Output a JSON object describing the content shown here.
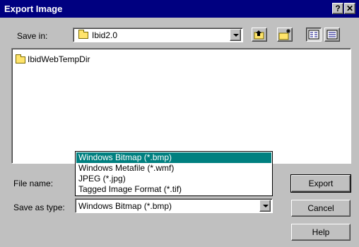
{
  "window": {
    "title": "Export Image",
    "help_glyph": "?",
    "close_glyph": "✕"
  },
  "save_in": {
    "label": "Save in:",
    "value": "Ibid2.0"
  },
  "toolbar_icons": [
    "up-one-level-icon",
    "create-new-folder-icon",
    "list-view-icon",
    "details-view-icon"
  ],
  "files": [
    {
      "name": "IbidWebTempDir",
      "icon": "folder-icon"
    }
  ],
  "file_name": {
    "label": "File name:",
    "value": ""
  },
  "save_as_type": {
    "label": "Save as type:",
    "value": "Windows Bitmap (*.bmp)",
    "options": [
      "Windows Bitmap (*.bmp)",
      "Windows Metafile (*.wmf)",
      "JPEG (*.jpg)",
      "Tagged Image Format (*.tif)"
    ],
    "selected_index": 0
  },
  "buttons": {
    "export": "Export",
    "cancel": "Cancel",
    "help": "Help"
  },
  "colors": {
    "titlebar": "#000080",
    "selection": "#008080",
    "face": "#c0c0c0"
  }
}
